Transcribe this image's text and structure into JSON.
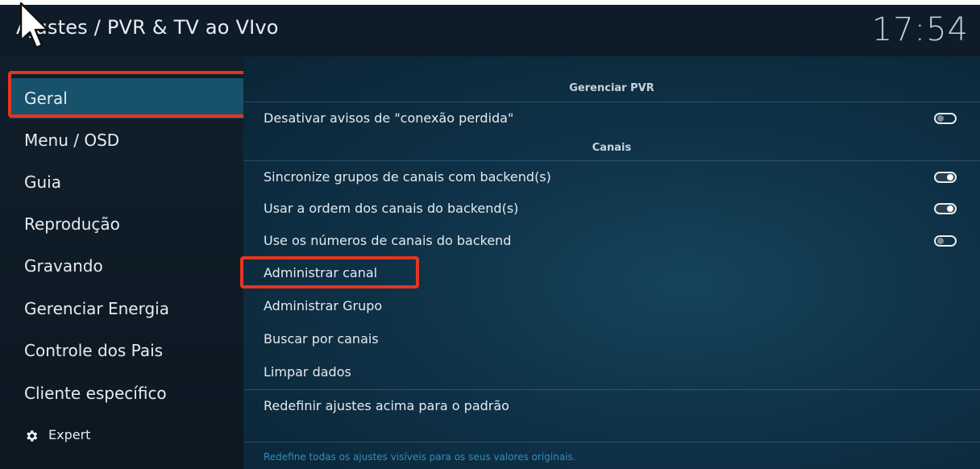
{
  "header": {
    "title": "Ajustes / PVR & TV ao VIvo",
    "clock": "17:54"
  },
  "sidebar": {
    "items": [
      {
        "label": "Geral"
      },
      {
        "label": "Menu / OSD"
      },
      {
        "label": "Guia"
      },
      {
        "label": "Reprodução"
      },
      {
        "label": "Gravando"
      },
      {
        "label": "Gerenciar Energia"
      },
      {
        "label": "Controle dos Pais"
      },
      {
        "label": "Cliente específico"
      }
    ],
    "expert": {
      "label": "Expert",
      "icon": "gear-icon"
    }
  },
  "content": {
    "sections": [
      {
        "header": "Gerenciar PVR"
      },
      {
        "header": "Canais"
      }
    ],
    "settings": [
      {
        "label": "Desativar avisos de \"conexão perdida\"",
        "toggle": "off"
      },
      {
        "label": "Sincronize grupos de canais com backend(s)",
        "toggle": "on"
      },
      {
        "label": "Usar a ordem dos canais do backend(s)",
        "toggle": "on"
      },
      {
        "label": "Use os números de canais do backend",
        "toggle": "off"
      }
    ],
    "actions": [
      {
        "label": "Administrar canal"
      },
      {
        "label": "Administrar Grupo"
      },
      {
        "label": "Buscar por canais"
      },
      {
        "label": "Limpar dados"
      },
      {
        "label": "Redefinir ajustes acima para o padrão"
      }
    ],
    "hint": "Redefine todas os ajustes visíveis para os seus valores originais."
  },
  "colors": {
    "highlight_outline": "#e43521",
    "accent": "#17516b",
    "hint": "#2f8fbe"
  }
}
